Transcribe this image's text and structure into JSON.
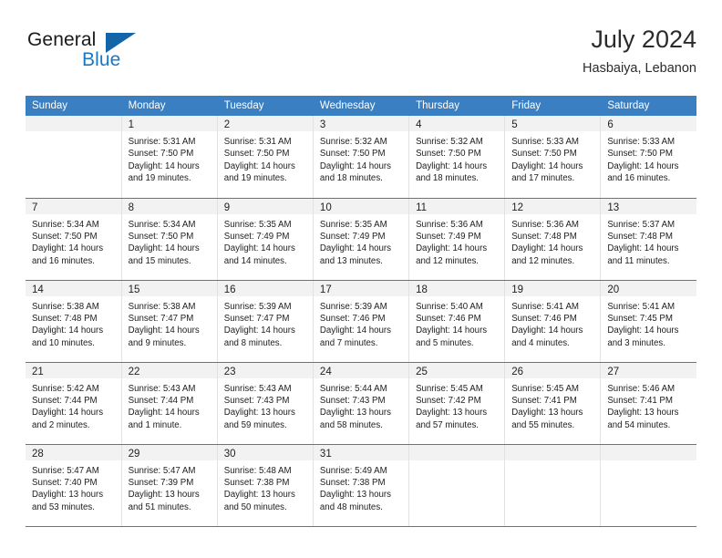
{
  "brand": {
    "word_one": "General",
    "word_two": "Blue",
    "triangle_color": "#1465a8",
    "blue_color": "#1878c8"
  },
  "header": {
    "title": "July 2024",
    "subtitle": "Hasbaiya, Lebanon"
  },
  "theme": {
    "header_row_bg": "#3a7fc1",
    "daynum_bg": "#f2f2f2",
    "row_rule": "#3a7fc1",
    "cell_divider": "#e2e2e2"
  },
  "weekdays": [
    "Sunday",
    "Monday",
    "Tuesday",
    "Wednesday",
    "Thursday",
    "Friday",
    "Saturday"
  ],
  "weeks": [
    [
      {
        "day": "",
        "sunrise": "",
        "sunset": "",
        "daylight_line1": "",
        "daylight_line2": ""
      },
      {
        "day": "1",
        "sunrise": "Sunrise: 5:31 AM",
        "sunset": "Sunset: 7:50 PM",
        "daylight_line1": "Daylight: 14 hours",
        "daylight_line2": "and 19 minutes."
      },
      {
        "day": "2",
        "sunrise": "Sunrise: 5:31 AM",
        "sunset": "Sunset: 7:50 PM",
        "daylight_line1": "Daylight: 14 hours",
        "daylight_line2": "and 19 minutes."
      },
      {
        "day": "3",
        "sunrise": "Sunrise: 5:32 AM",
        "sunset": "Sunset: 7:50 PM",
        "daylight_line1": "Daylight: 14 hours",
        "daylight_line2": "and 18 minutes."
      },
      {
        "day": "4",
        "sunrise": "Sunrise: 5:32 AM",
        "sunset": "Sunset: 7:50 PM",
        "daylight_line1": "Daylight: 14 hours",
        "daylight_line2": "and 18 minutes."
      },
      {
        "day": "5",
        "sunrise": "Sunrise: 5:33 AM",
        "sunset": "Sunset: 7:50 PM",
        "daylight_line1": "Daylight: 14 hours",
        "daylight_line2": "and 17 minutes."
      },
      {
        "day": "6",
        "sunrise": "Sunrise: 5:33 AM",
        "sunset": "Sunset: 7:50 PM",
        "daylight_line1": "Daylight: 14 hours",
        "daylight_line2": "and 16 minutes."
      }
    ],
    [
      {
        "day": "7",
        "sunrise": "Sunrise: 5:34 AM",
        "sunset": "Sunset: 7:50 PM",
        "daylight_line1": "Daylight: 14 hours",
        "daylight_line2": "and 16 minutes."
      },
      {
        "day": "8",
        "sunrise": "Sunrise: 5:34 AM",
        "sunset": "Sunset: 7:50 PM",
        "daylight_line1": "Daylight: 14 hours",
        "daylight_line2": "and 15 minutes."
      },
      {
        "day": "9",
        "sunrise": "Sunrise: 5:35 AM",
        "sunset": "Sunset: 7:49 PM",
        "daylight_line1": "Daylight: 14 hours",
        "daylight_line2": "and 14 minutes."
      },
      {
        "day": "10",
        "sunrise": "Sunrise: 5:35 AM",
        "sunset": "Sunset: 7:49 PM",
        "daylight_line1": "Daylight: 14 hours",
        "daylight_line2": "and 13 minutes."
      },
      {
        "day": "11",
        "sunrise": "Sunrise: 5:36 AM",
        "sunset": "Sunset: 7:49 PM",
        "daylight_line1": "Daylight: 14 hours",
        "daylight_line2": "and 12 minutes."
      },
      {
        "day": "12",
        "sunrise": "Sunrise: 5:36 AM",
        "sunset": "Sunset: 7:48 PM",
        "daylight_line1": "Daylight: 14 hours",
        "daylight_line2": "and 12 minutes."
      },
      {
        "day": "13",
        "sunrise": "Sunrise: 5:37 AM",
        "sunset": "Sunset: 7:48 PM",
        "daylight_line1": "Daylight: 14 hours",
        "daylight_line2": "and 11 minutes."
      }
    ],
    [
      {
        "day": "14",
        "sunrise": "Sunrise: 5:38 AM",
        "sunset": "Sunset: 7:48 PM",
        "daylight_line1": "Daylight: 14 hours",
        "daylight_line2": "and 10 minutes."
      },
      {
        "day": "15",
        "sunrise": "Sunrise: 5:38 AM",
        "sunset": "Sunset: 7:47 PM",
        "daylight_line1": "Daylight: 14 hours",
        "daylight_line2": "and 9 minutes."
      },
      {
        "day": "16",
        "sunrise": "Sunrise: 5:39 AM",
        "sunset": "Sunset: 7:47 PM",
        "daylight_line1": "Daylight: 14 hours",
        "daylight_line2": "and 8 minutes."
      },
      {
        "day": "17",
        "sunrise": "Sunrise: 5:39 AM",
        "sunset": "Sunset: 7:46 PM",
        "daylight_line1": "Daylight: 14 hours",
        "daylight_line2": "and 7 minutes."
      },
      {
        "day": "18",
        "sunrise": "Sunrise: 5:40 AM",
        "sunset": "Sunset: 7:46 PM",
        "daylight_line1": "Daylight: 14 hours",
        "daylight_line2": "and 5 minutes."
      },
      {
        "day": "19",
        "sunrise": "Sunrise: 5:41 AM",
        "sunset": "Sunset: 7:46 PM",
        "daylight_line1": "Daylight: 14 hours",
        "daylight_line2": "and 4 minutes."
      },
      {
        "day": "20",
        "sunrise": "Sunrise: 5:41 AM",
        "sunset": "Sunset: 7:45 PM",
        "daylight_line1": "Daylight: 14 hours",
        "daylight_line2": "and 3 minutes."
      }
    ],
    [
      {
        "day": "21",
        "sunrise": "Sunrise: 5:42 AM",
        "sunset": "Sunset: 7:44 PM",
        "daylight_line1": "Daylight: 14 hours",
        "daylight_line2": "and 2 minutes."
      },
      {
        "day": "22",
        "sunrise": "Sunrise: 5:43 AM",
        "sunset": "Sunset: 7:44 PM",
        "daylight_line1": "Daylight: 14 hours",
        "daylight_line2": "and 1 minute."
      },
      {
        "day": "23",
        "sunrise": "Sunrise: 5:43 AM",
        "sunset": "Sunset: 7:43 PM",
        "daylight_line1": "Daylight: 13 hours",
        "daylight_line2": "and 59 minutes."
      },
      {
        "day": "24",
        "sunrise": "Sunrise: 5:44 AM",
        "sunset": "Sunset: 7:43 PM",
        "daylight_line1": "Daylight: 13 hours",
        "daylight_line2": "and 58 minutes."
      },
      {
        "day": "25",
        "sunrise": "Sunrise: 5:45 AM",
        "sunset": "Sunset: 7:42 PM",
        "daylight_line1": "Daylight: 13 hours",
        "daylight_line2": "and 57 minutes."
      },
      {
        "day": "26",
        "sunrise": "Sunrise: 5:45 AM",
        "sunset": "Sunset: 7:41 PM",
        "daylight_line1": "Daylight: 13 hours",
        "daylight_line2": "and 55 minutes."
      },
      {
        "day": "27",
        "sunrise": "Sunrise: 5:46 AM",
        "sunset": "Sunset: 7:41 PM",
        "daylight_line1": "Daylight: 13 hours",
        "daylight_line2": "and 54 minutes."
      }
    ],
    [
      {
        "day": "28",
        "sunrise": "Sunrise: 5:47 AM",
        "sunset": "Sunset: 7:40 PM",
        "daylight_line1": "Daylight: 13 hours",
        "daylight_line2": "and 53 minutes."
      },
      {
        "day": "29",
        "sunrise": "Sunrise: 5:47 AM",
        "sunset": "Sunset: 7:39 PM",
        "daylight_line1": "Daylight: 13 hours",
        "daylight_line2": "and 51 minutes."
      },
      {
        "day": "30",
        "sunrise": "Sunrise: 5:48 AM",
        "sunset": "Sunset: 7:38 PM",
        "daylight_line1": "Daylight: 13 hours",
        "daylight_line2": "and 50 minutes."
      },
      {
        "day": "31",
        "sunrise": "Sunrise: 5:49 AM",
        "sunset": "Sunset: 7:38 PM",
        "daylight_line1": "Daylight: 13 hours",
        "daylight_line2": "and 48 minutes."
      },
      {
        "day": "",
        "sunrise": "",
        "sunset": "",
        "daylight_line1": "",
        "daylight_line2": ""
      },
      {
        "day": "",
        "sunrise": "",
        "sunset": "",
        "daylight_line1": "",
        "daylight_line2": ""
      },
      {
        "day": "",
        "sunrise": "",
        "sunset": "",
        "daylight_line1": "",
        "daylight_line2": ""
      }
    ]
  ]
}
